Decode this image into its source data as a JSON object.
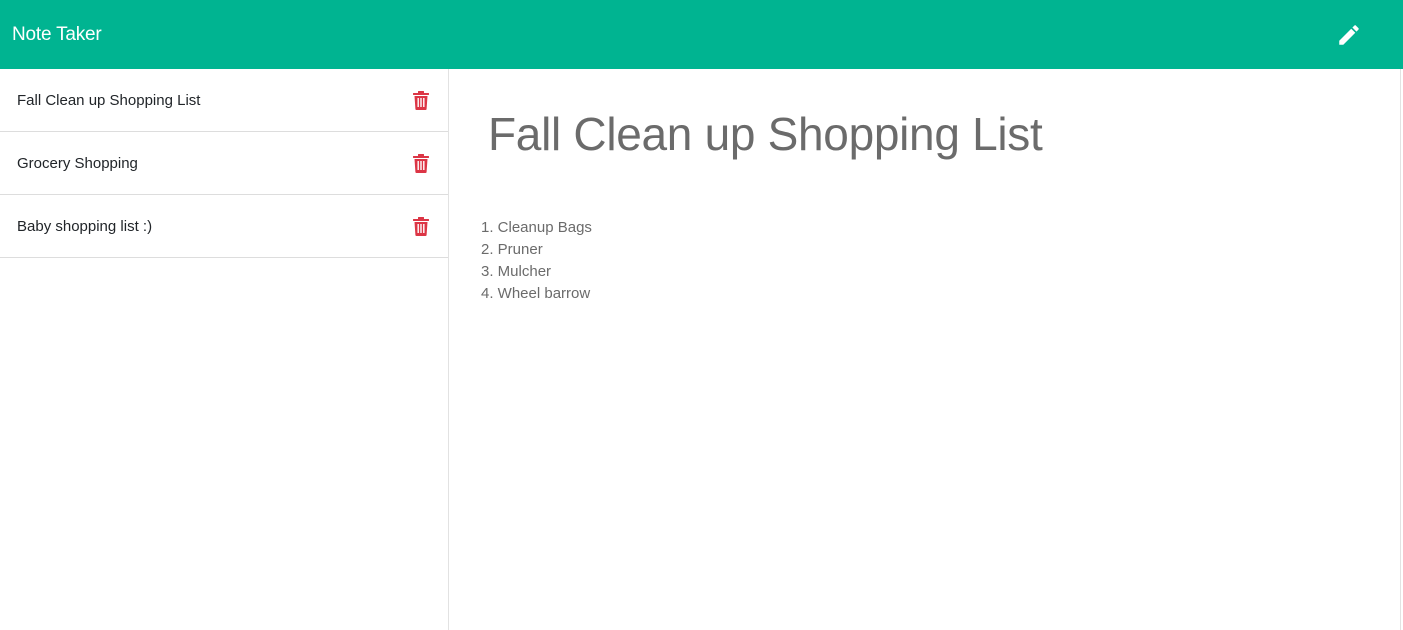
{
  "app": {
    "title": "Note Taker"
  },
  "colors": {
    "navbar": "#00b491",
    "delete_icon": "#dc3545"
  },
  "notes": [
    {
      "title": "Fall Clean up Shopping List",
      "icon": "trash-icon"
    },
    {
      "title": "Grocery Shopping",
      "icon": "trash-icon"
    },
    {
      "title": "Baby shopping list :)",
      "icon": "trash-icon"
    }
  ],
  "active_note": {
    "title": "Fall Clean up Shopping List",
    "lines": [
      "1. Cleanup Bags",
      "2. Pruner",
      "3. Mulcher",
      "4. Wheel barrow"
    ]
  },
  "toolbar": {
    "new_note_icon": "pencil-icon"
  }
}
